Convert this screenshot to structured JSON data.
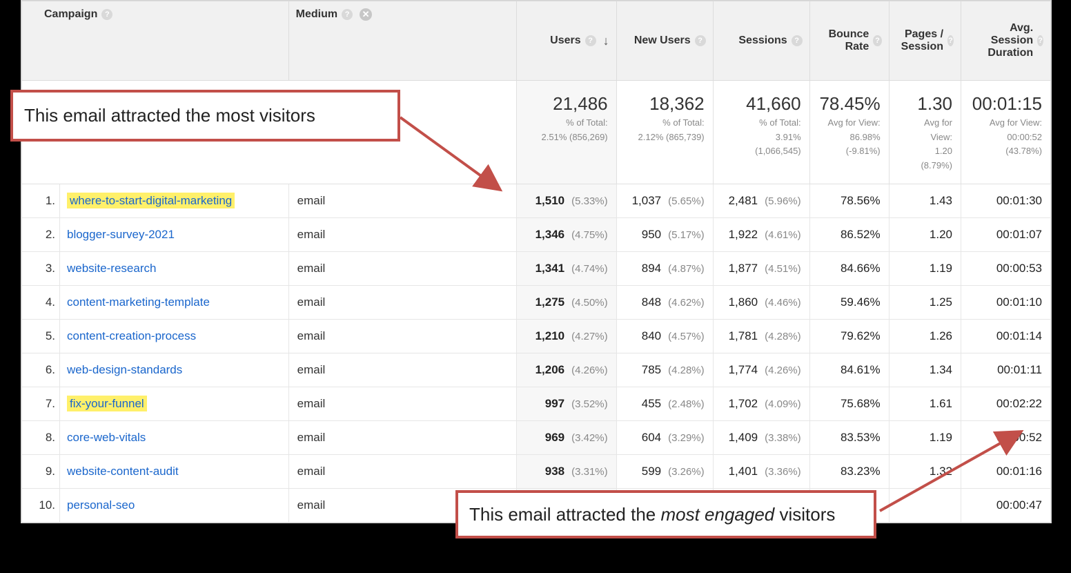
{
  "headers": {
    "campaign": "Campaign",
    "medium": "Medium",
    "users": "Users",
    "new_users": "New Users",
    "sessions": "Sessions",
    "bounce_rate": "Bounce Rate",
    "pages_session": "Pages / Session",
    "avg_duration": "Avg. Session Duration"
  },
  "annotations": {
    "top": "This email attracted the most visitors",
    "bottom_pre": "This email attracted the ",
    "bottom_em": "most engaged",
    "bottom_post": " visitors"
  },
  "totals": {
    "users": {
      "big": "21,486",
      "sub1": "% of Total:",
      "sub2": "2.51% (856,269)"
    },
    "new_users": {
      "big": "18,362",
      "sub1": "% of Total:",
      "sub2": "2.12% (865,739)"
    },
    "sessions": {
      "big": "41,660",
      "sub1": "% of Total:",
      "sub2": "3.91%",
      "sub3": "(1,066,545)"
    },
    "bounce_rate": {
      "big": "78.45%",
      "sub1": "Avg for View:",
      "sub2": "86.98%",
      "sub3": "(-9.81%)"
    },
    "pages_session": {
      "big": "1.30",
      "sub1": "Avg for",
      "sub2": "View:",
      "sub3": "1.20",
      "sub4": "(8.79%)"
    },
    "avg_duration": {
      "big": "00:01:15",
      "sub1": "Avg for View:",
      "sub2": "00:00:52",
      "sub3": "(43.78%)"
    }
  },
  "rows": [
    {
      "idx": "1.",
      "campaign": "where-to-start-digital-marketing",
      "hl": true,
      "medium": "email",
      "users": "1,510",
      "users_pct": "(5.33%)",
      "new_users": "1,037",
      "new_users_pct": "(5.65%)",
      "sessions": "2,481",
      "sessions_pct": "(5.96%)",
      "bounce": "78.56%",
      "pages": "1.43",
      "dur": "00:01:30"
    },
    {
      "idx": "2.",
      "campaign": "blogger-survey-2021",
      "hl": false,
      "medium": "email",
      "users": "1,346",
      "users_pct": "(4.75%)",
      "new_users": "950",
      "new_users_pct": "(5.17%)",
      "sessions": "1,922",
      "sessions_pct": "(4.61%)",
      "bounce": "86.52%",
      "pages": "1.20",
      "dur": "00:01:07"
    },
    {
      "idx": "3.",
      "campaign": "website-research",
      "hl": false,
      "medium": "email",
      "users": "1,341",
      "users_pct": "(4.74%)",
      "new_users": "894",
      "new_users_pct": "(4.87%)",
      "sessions": "1,877",
      "sessions_pct": "(4.51%)",
      "bounce": "84.66%",
      "pages": "1.19",
      "dur": "00:00:53"
    },
    {
      "idx": "4.",
      "campaign": "content-marketing-template",
      "hl": false,
      "medium": "email",
      "users": "1,275",
      "users_pct": "(4.50%)",
      "new_users": "848",
      "new_users_pct": "(4.62%)",
      "sessions": "1,860",
      "sessions_pct": "(4.46%)",
      "bounce": "59.46%",
      "pages": "1.25",
      "dur": "00:01:10"
    },
    {
      "idx": "5.",
      "campaign": "content-creation-process",
      "hl": false,
      "medium": "email",
      "users": "1,210",
      "users_pct": "(4.27%)",
      "new_users": "840",
      "new_users_pct": "(4.57%)",
      "sessions": "1,781",
      "sessions_pct": "(4.28%)",
      "bounce": "79.62%",
      "pages": "1.26",
      "dur": "00:01:14"
    },
    {
      "idx": "6.",
      "campaign": "web-design-standards",
      "hl": false,
      "medium": "email",
      "users": "1,206",
      "users_pct": "(4.26%)",
      "new_users": "785",
      "new_users_pct": "(4.28%)",
      "sessions": "1,774",
      "sessions_pct": "(4.26%)",
      "bounce": "84.61%",
      "pages": "1.34",
      "dur": "00:01:11"
    },
    {
      "idx": "7.",
      "campaign": "fix-your-funnel",
      "hl": true,
      "medium": "email",
      "users": "997",
      "users_pct": "(3.52%)",
      "new_users": "455",
      "new_users_pct": "(2.48%)",
      "sessions": "1,702",
      "sessions_pct": "(4.09%)",
      "bounce": "75.68%",
      "pages": "1.61",
      "dur": "00:02:22"
    },
    {
      "idx": "8.",
      "campaign": "core-web-vitals",
      "hl": false,
      "medium": "email",
      "users": "969",
      "users_pct": "(3.42%)",
      "new_users": "604",
      "new_users_pct": "(3.29%)",
      "sessions": "1,409",
      "sessions_pct": "(3.38%)",
      "bounce": "83.53%",
      "pages": "1.19",
      "dur": "00:00:52"
    },
    {
      "idx": "9.",
      "campaign": "website-content-audit",
      "hl": false,
      "medium": "email",
      "users": "938",
      "users_pct": "(3.31%)",
      "new_users": "599",
      "new_users_pct": "(3.26%)",
      "sessions": "1,401",
      "sessions_pct": "(3.36%)",
      "bounce": "83.23%",
      "pages": "1.32",
      "dur": "00:01:16"
    },
    {
      "idx": "10.",
      "campaign": "personal-seo",
      "hl": false,
      "medium": "email",
      "users": "",
      "users_pct": "",
      "new_users": "",
      "new_users_pct": "",
      "sessions": "",
      "sessions_pct": "",
      "bounce": "",
      "pages": "",
      "dur": "00:00:47"
    }
  ]
}
